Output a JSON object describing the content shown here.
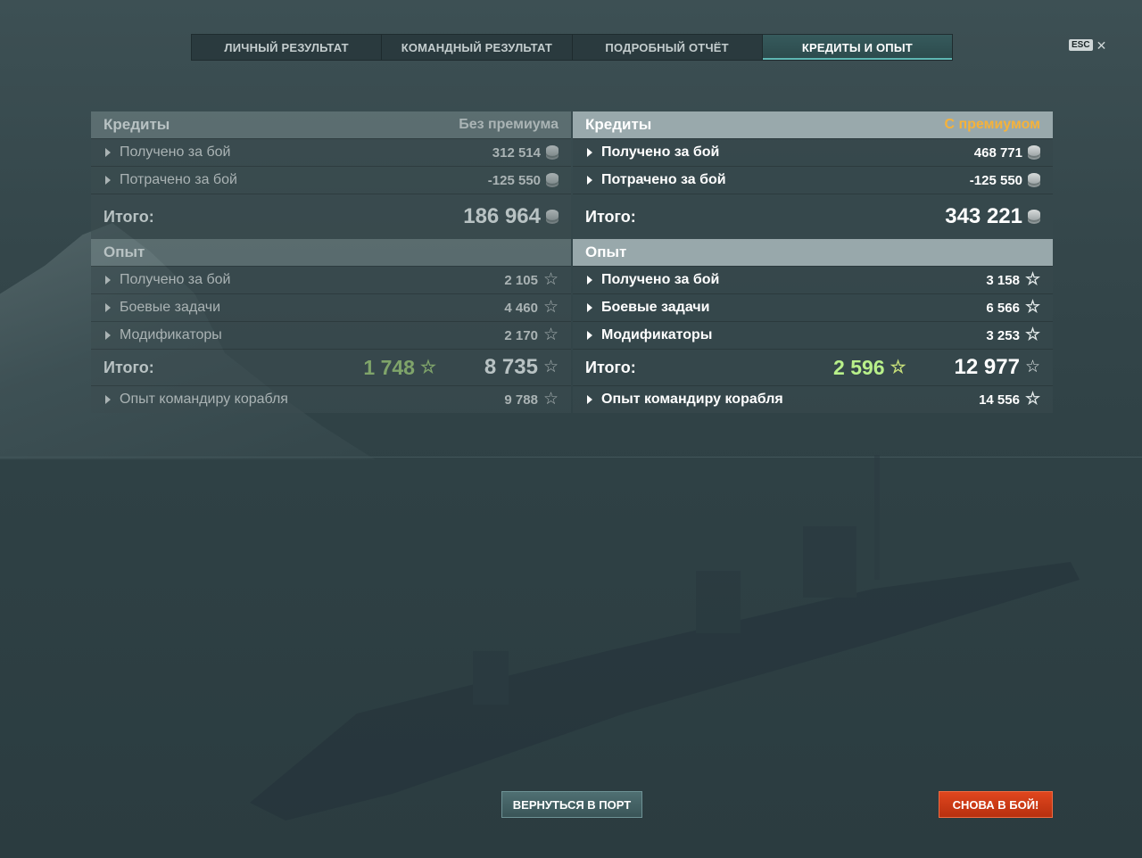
{
  "tabs": [
    {
      "label": "ЛИЧНЫЙ РЕЗУЛЬТАТ"
    },
    {
      "label": "КОМАНДНЫЙ РЕЗУЛЬТАТ"
    },
    {
      "label": "ПОДРОБНЫЙ ОТЧЁТ"
    },
    {
      "label": "КРЕДИТЫ И ОПЫТ"
    }
  ],
  "active_tab": "КРЕДИТЫ И ОПЫТ",
  "esc": {
    "key": "ESC",
    "close": "✕"
  },
  "no_premium": {
    "credits": {
      "title": "Кредиты",
      "subtitle": "Без премиума",
      "earned": {
        "label": "Получено за бой",
        "value": "312 514"
      },
      "spent": {
        "label": "Потрачено за бой",
        "value": "-125 550"
      },
      "total": {
        "label": "Итого:",
        "value": "186 964"
      }
    },
    "exp": {
      "title": "Опыт",
      "earned": {
        "label": "Получено за бой",
        "value": "2 105"
      },
      "tasks": {
        "label": "Боевые задачи",
        "value": "4 460"
      },
      "mods": {
        "label": "Модификаторы",
        "value": "2 170"
      },
      "total": {
        "label": "Итого:",
        "free_value": "1 748",
        "value": "8 735"
      },
      "commander": {
        "label": "Опыт командиру корабля",
        "value": "9 788"
      }
    }
  },
  "premium": {
    "credits": {
      "title": "Кредиты",
      "subtitle": "С премиумом",
      "earned": {
        "label": "Получено за бой",
        "value": "468 771"
      },
      "spent": {
        "label": "Потрачено за бой",
        "value": "-125 550"
      },
      "total": {
        "label": "Итого:",
        "value": "343 221"
      }
    },
    "exp": {
      "title": "Опыт",
      "earned": {
        "label": "Получено за бой",
        "value": "3 158"
      },
      "tasks": {
        "label": "Боевые задачи",
        "value": "6 566"
      },
      "mods": {
        "label": "Модификаторы",
        "value": "3 253"
      },
      "total": {
        "label": "Итого:",
        "free_value": "2 596",
        "value": "12 977"
      },
      "commander": {
        "label": "Опыт командиру корабля",
        "value": "14 556"
      }
    }
  },
  "buttons": {
    "port": "ВЕРНУТЬСЯ В ПОРТ",
    "battle": "СНОВА В БОЙ!"
  },
  "colors": {
    "accent_tab": "#5fb7b3",
    "premium_label": "#f5b23a",
    "free_xp_premium": "#b8f08a",
    "free_xp_basic": "#7fa46a",
    "battle_button": "#d13f18"
  },
  "icons": {
    "credits": "silver-coin-icon",
    "exp": "star-icon",
    "free_exp": "free-xp-star-icon",
    "expand": "triangle-right-icon"
  }
}
